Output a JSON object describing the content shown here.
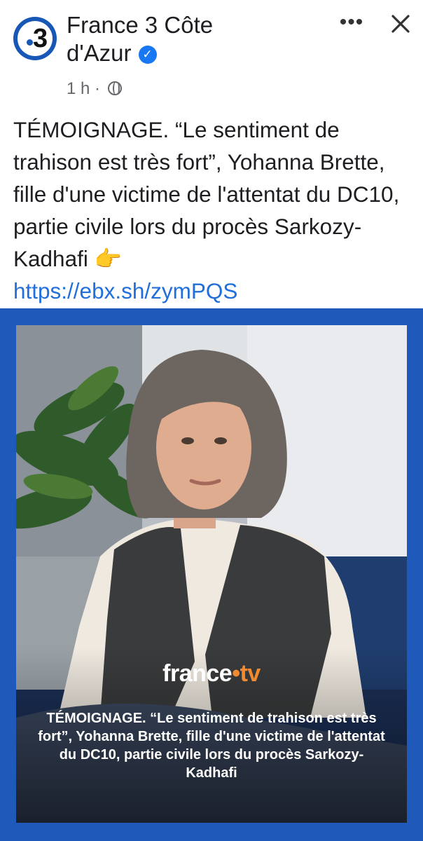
{
  "post": {
    "page_name": "France 3 Côte d'Azur",
    "avatar_text": "3",
    "timestamp": "1 h",
    "separator": "·",
    "more_label": "•••",
    "text": "TÉMOIGNAGE. “Le sentiment de trahison est très fort”, Yohanna Brette, fille d'une victime de l'attentat du DC10, partie civile lors du procès Sarkozy-Kadhafi 👉",
    "link": "https://ebx.sh/zymPQS"
  },
  "media": {
    "brand_main": "france",
    "brand_dot": "•",
    "brand_tv": "tv",
    "caption": "TÉMOIGNAGE. “Le sentiment de trahison est très fort”, Yohanna Brette, fille d'une victime de l'attentat du DC10, partie civile lors du procès Sarkozy-Kadhafi"
  },
  "colors": {
    "brand_blue": "#1757b6",
    "link_blue": "#216fdb",
    "verified_blue": "#1877f2",
    "frame_blue": "#1f59b9",
    "ftv_orange": "#f28a2f"
  },
  "icons": {
    "verified": "verified-badge-icon",
    "globe": "globe-icon",
    "more": "more-options-icon",
    "close": "close-icon"
  }
}
